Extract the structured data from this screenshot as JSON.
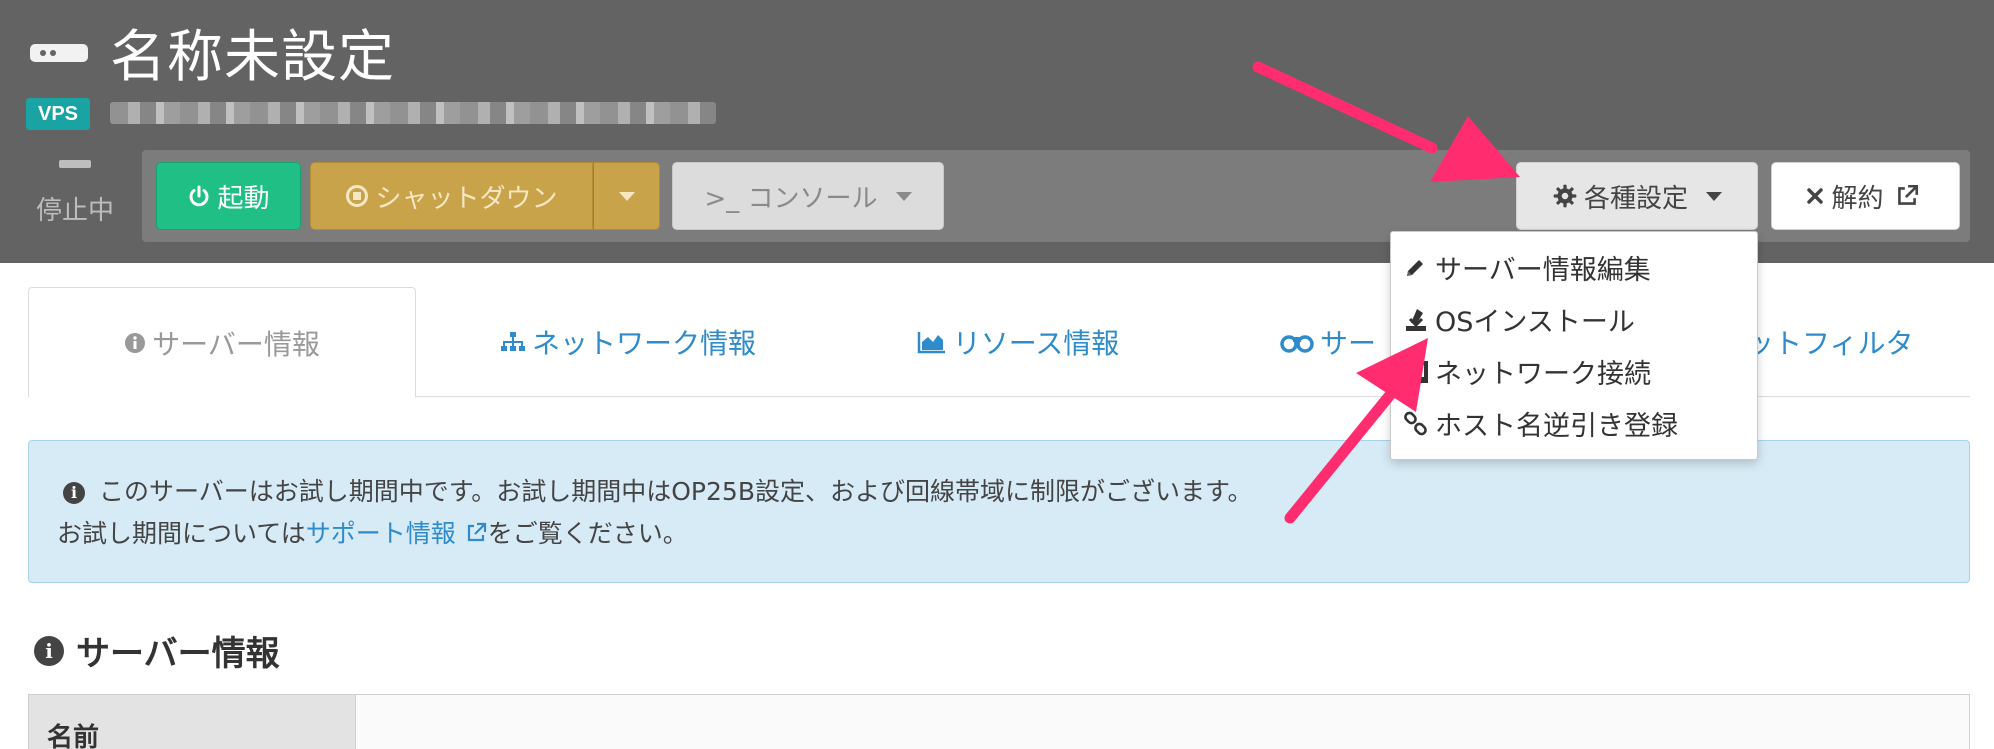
{
  "header": {
    "server_title": "名称未設定",
    "badge": "VPS",
    "status": "停止中"
  },
  "toolbar": {
    "start_label": "起動",
    "shutdown_label": "シャットダウン",
    "console_label": ">_ コンソール",
    "settings_label": "各種設定",
    "cancel_label": "解約"
  },
  "tabs": [
    {
      "label": "サーバー情報",
      "icon": "info-icon",
      "active": true
    },
    {
      "label": "ネットワーク情報",
      "icon": "sitemap-icon"
    },
    {
      "label": "リソース情報",
      "icon": "area-chart-icon"
    },
    {
      "label": "サー",
      "icon": "binoculars-icon"
    },
    {
      "label": "ットフィルタ",
      "icon": ""
    }
  ],
  "settings_menu": {
    "items": [
      {
        "label": "サーバー情報編集",
        "icon": "pencil-icon"
      },
      {
        "label": "OSインストール",
        "icon": "install-icon"
      },
      {
        "label": "ネットワーク接続",
        "icon": "ethernet-icon"
      },
      {
        "label": "ホスト名逆引き登録",
        "icon": "link-icon"
      }
    ]
  },
  "alert": {
    "line1": "このサーバーはお試し期間中です。お試し期間中はOP25B設定、および回線帯域に制限がございます。",
    "line2_prefix": "お試し期間については",
    "line2_link": "サポート情報",
    "line2_suffix": "をご覧ください。"
  },
  "section": {
    "title": "サーバー情報",
    "rows": [
      {
        "label": "名前",
        "value": ""
      }
    ]
  },
  "colors": {
    "header_bg": "#636363",
    "start_green": "#1fbf86",
    "shutdown_gold": "#c9a34a",
    "link_blue": "#2f8bc9",
    "alert_bg": "#d7ebf6",
    "badge_teal": "#1aa3a3",
    "arrow_pink": "#ff2d6f"
  }
}
